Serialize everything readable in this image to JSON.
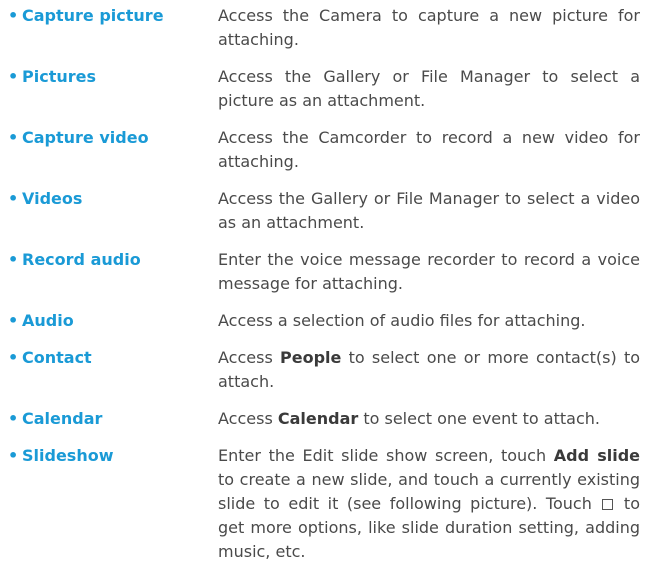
{
  "entries": [
    {
      "term": "Capture picture",
      "desc": "Access the Camera to capture a new picture for attaching."
    },
    {
      "term": "Pictures",
      "desc": "Access the Gallery or File Manager to select a picture as an attachment."
    },
    {
      "term": "Capture video",
      "desc": "Access the Camcorder to record a new video for attaching."
    },
    {
      "term": "Videos",
      "desc": "Access the Gallery or File Manager to select a video as an attachment."
    },
    {
      "term": "Record audio",
      "desc": "Enter the voice message recorder to record a voice message for attaching."
    },
    {
      "term": "Audio",
      "desc": "Access a selection of audio files for attaching."
    },
    {
      "term": "Contact",
      "desc_before": "Access ",
      "desc_bold": "People",
      "desc_after": " to select one or more contact(s) to attach."
    },
    {
      "term": "Calendar",
      "desc_before": "Access ",
      "desc_bold": "Calendar",
      "desc_after": " to select one event to attach."
    },
    {
      "term": "Slideshow",
      "desc_part1": "Enter the Edit slide show screen, touch ",
      "desc_bold1": "Add slide",
      "desc_part2": " to create a new slide, and touch a currently existing slide to edit it (see following picture). Touch ",
      "desc_icon": "menu-square-icon",
      "desc_part3": " to get more options, like slide duration setting, adding music, etc."
    }
  ],
  "colors": {
    "term": "#1a9ad6",
    "text": "#4a4a4a"
  },
  "bullet_glyph": "•"
}
